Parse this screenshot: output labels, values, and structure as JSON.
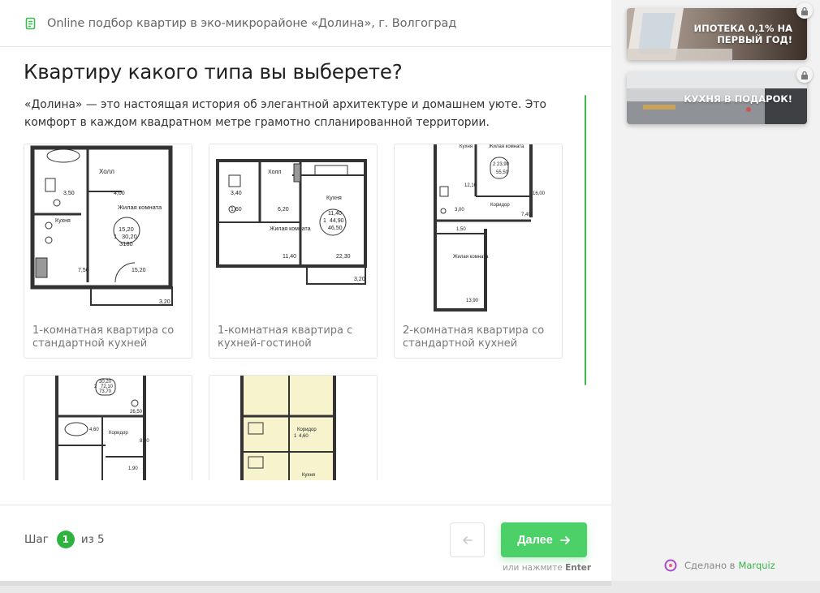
{
  "header": {
    "title": "Online подбор квартир в эко-микрорайоне «Долина», г. Волгоград",
    "icon": "document-list-icon"
  },
  "question": {
    "title": "Квартиру какого типа вы выберете?",
    "description": "«Долина» — это настоящая история об элегантной архитектуре и домашнем уюте. Это комфорт в каждом квадратном метре грамотно спланированной территории."
  },
  "cards": [
    {
      "caption": "1-комнатная квартира со стандартной кухней"
    },
    {
      "caption": "1-комнатная квартира с кухней-гостиной"
    },
    {
      "caption": "2-комнатная квартира со стандартной кухней"
    },
    {
      "caption": ""
    },
    {
      "caption": ""
    }
  ],
  "plan_labels": {
    "c1": {
      "hall": "Холл",
      "living": "Жилая комната",
      "kitchen": "Кухня",
      "n1": "3,50",
      "n2": "4,00",
      "n3": "15,20",
      "n4": "1",
      "n5": "30,20",
      "n6": "3180",
      "n7": "7,50",
      "n8": "15,20",
      "n9": "3,20"
    },
    "c2": {
      "hall": "Холл",
      "kitchen": "Кухня",
      "living": "Жилая комната",
      "n1": "3,40",
      "n2": "1,60",
      "n3": "6,20",
      "n4": "11,40",
      "n5": "1",
      "n6": "44,90",
      "n7": "46,50",
      "n8": "11,40",
      "n9": "22,30",
      "n10": "3,20"
    },
    "c3": {
      "kitchen": "Кухня",
      "living": "Жилая комната",
      "living2": "Жилая комната",
      "corridor": "Коридор",
      "n1": "2",
      "n2": "23,90",
      "n3": "55,50",
      "n4": "12,10",
      "n5": "3,00",
      "n6": "1,50",
      "n7": "16,00",
      "n8": "7,40",
      "n9": "13,90"
    },
    "c4": {
      "corridor": "Коридор",
      "n1": "30,20",
      "n2": "2",
      "n3": "72,10",
      "n4": "73,70",
      "n5": "26,50",
      "n6": "4,60",
      "n7": "8,90",
      "n8": "1,90"
    },
    "c5": {
      "corridor": "Коридор",
      "kitchen": "Кухня",
      "n1": "1",
      "n2": "4,60"
    }
  },
  "footer": {
    "step_label": "Шаг",
    "step_current": "1",
    "step_of": "из 5",
    "next_label": "Далее",
    "hint_prefix": "или нажмите",
    "hint_key": "Enter"
  },
  "sidebar": {
    "promos": [
      {
        "text": "ИПОТЕКА 0,1% НА ПЕРВЫЙ ГОД!",
        "line1": "ИПОТЕКА 0,1% НА",
        "line2": "ПЕРВЫЙ ГОД!"
      },
      {
        "text": "КУХНЯ В ПОДАРОК!"
      }
    ],
    "made_with": "Сделано в",
    "brand": "Marquiz"
  },
  "colors": {
    "accent": "#4cd168",
    "accent_dark": "#2fb33f",
    "text": "#222222",
    "muted": "#777777"
  }
}
